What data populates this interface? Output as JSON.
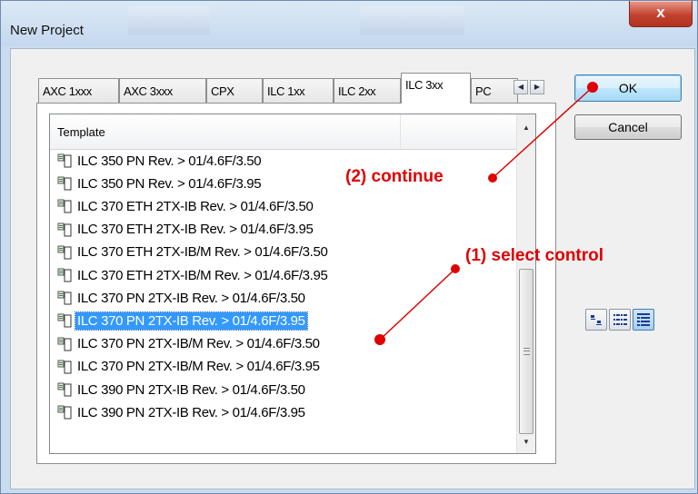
{
  "window": {
    "title": "New Project",
    "close_glyph": "x"
  },
  "tabs": [
    {
      "label": "AXC 1xxx",
      "active": false
    },
    {
      "label": "AXC 3xxx",
      "active": false
    },
    {
      "label": "CPX",
      "active": false
    },
    {
      "label": "ILC 1xx",
      "active": false
    },
    {
      "label": "ILC 2xx",
      "active": false
    },
    {
      "label": "ILC 3xx",
      "active": true
    },
    {
      "label": "PC",
      "active": false
    }
  ],
  "tab_scroll": {
    "left_icon": "tab-scroll-left-icon",
    "right_icon": "tab-scroll-right-icon"
  },
  "list": {
    "column_header": "Template",
    "selected_index": 7,
    "items": [
      "ILC 350 PN Rev. > 01/4.6F/3.50",
      "ILC 350 PN Rev. > 01/4.6F/3.95",
      "ILC 370 ETH 2TX-IB Rev. > 01/4.6F/3.50",
      "ILC 370 ETH 2TX-IB Rev. > 01/4.6F/3.95",
      "ILC 370 ETH 2TX-IB/M Rev. > 01/4.6F/3.50",
      "ILC 370 ETH 2TX-IB/M Rev. > 01/4.6F/3.95",
      "ILC 370 PN 2TX-IB Rev. > 01/4.6F/3.50",
      "ILC 370 PN 2TX-IB Rev. > 01/4.6F/3.95",
      "ILC 370 PN 2TX-IB/M Rev. > 01/4.6F/3.50",
      "ILC 370 PN 2TX-IB/M Rev. > 01/4.6F/3.95",
      "ILC 390 PN 2TX-IB Rev. > 01/4.6F/3.50",
      "ILC 390 PN 2TX-IB Rev. > 01/4.6F/3.95"
    ],
    "item_icon": "project-template-icon"
  },
  "buttons": {
    "ok": "OK",
    "cancel": "Cancel"
  },
  "view_buttons": [
    {
      "icon": "large-icons-view-icon",
      "active": false
    },
    {
      "icon": "list-view-icon",
      "active": false
    },
    {
      "icon": "details-view-icon",
      "active": true
    }
  ],
  "annotations": {
    "step1": "(1) select control",
    "step2": "(2) continue",
    "color": "#e00000"
  },
  "colors": {
    "selection": "#3399ff",
    "title_bar": "#c9dcef",
    "close_button": "#c4422f"
  }
}
